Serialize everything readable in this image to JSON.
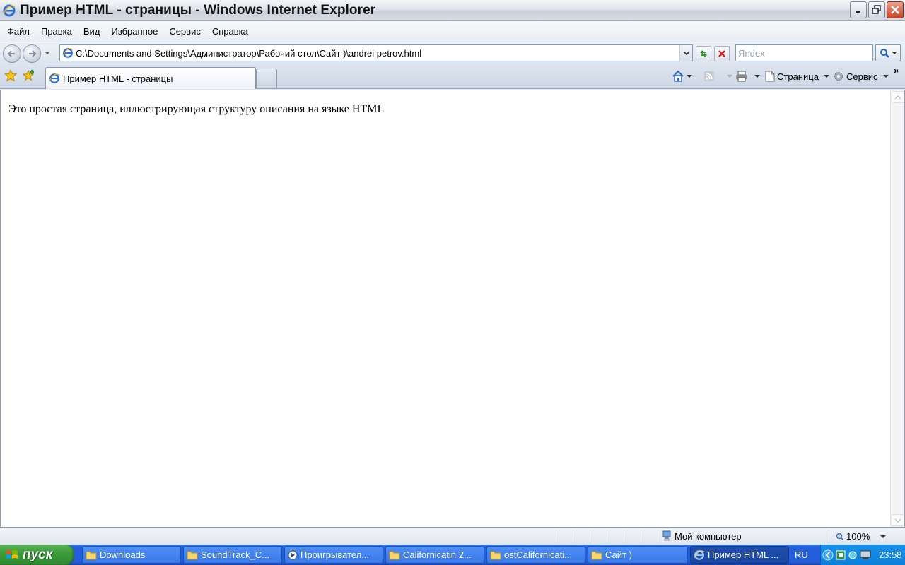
{
  "window": {
    "title": "Пример HTML - страницы - Windows Internet Explorer"
  },
  "menu": {
    "items": [
      "Файл",
      "Правка",
      "Вид",
      "Избранное",
      "Сервис",
      "Справка"
    ]
  },
  "address": {
    "url": "C:\\Documents and Settings\\Администратор\\Рабочий стол\\Сайт )\\andrei petrov.html"
  },
  "search": {
    "placeholder": "Яndex"
  },
  "tabs": {
    "active_label": "Пример HTML - страницы"
  },
  "commands": {
    "page_label": "Страница",
    "tools_label": "Сервис"
  },
  "page": {
    "text": "Это простая страница, иллюстрирующая структуру описания на языке HTML"
  },
  "status": {
    "zone_label": "Мой компьютер",
    "zoom": "100%"
  },
  "taskbar": {
    "start_label": "пуск",
    "tasks": [
      {
        "label": "Downloads",
        "icon": "folder-icon"
      },
      {
        "label": "SoundTrack_C...",
        "icon": "folder-icon"
      },
      {
        "label": "Проигрывател...",
        "icon": "media-player-icon"
      },
      {
        "label": "Californicatin 2...",
        "icon": "folder-icon"
      },
      {
        "label": "ostCalifornicati...",
        "icon": "folder-icon"
      },
      {
        "label": "Сайт )",
        "icon": "folder-icon"
      },
      {
        "label": "Пример HTML ...",
        "icon": "ie-icon"
      }
    ],
    "language": "RU",
    "clock": "23:58"
  },
  "colors": {
    "taskbar_blue": "#245edb",
    "start_green": "#3c9d3b",
    "close_red": "#c8442a"
  }
}
